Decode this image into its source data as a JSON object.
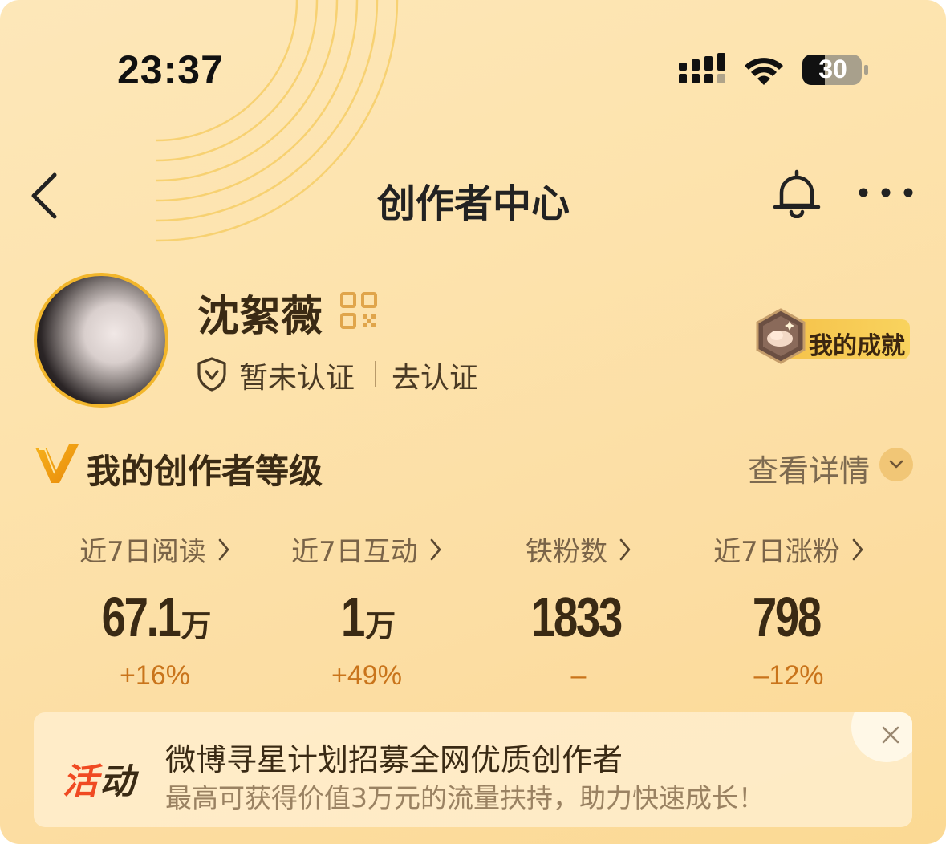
{
  "status_bar": {
    "time": "23:37",
    "battery_level": "30",
    "icons": [
      "signal-icon",
      "wifi-icon",
      "battery-icon"
    ]
  },
  "nav": {
    "title": "创作者中心",
    "back_icon": "chevron-left-icon",
    "bell_icon": "bell-icon",
    "more_icon": "more-horizontal-icon"
  },
  "profile": {
    "name": "沈絮薇",
    "qr_icon": "qr-code-icon",
    "verify_status": "暂未认证",
    "verify_link": "去认证",
    "achievement_label": "我的成就"
  },
  "level": {
    "title": "我的创作者等级",
    "detail_link": "查看详情"
  },
  "stats": [
    {
      "label": "近7日阅读",
      "value": "67.1",
      "unit": "万",
      "change": "+16%"
    },
    {
      "label": "近7日互动",
      "value": "1",
      "unit": "万",
      "change": "+49%"
    },
    {
      "label": "铁粉数",
      "value": "1833",
      "unit": "",
      "change": "–"
    },
    {
      "label": "近7日涨粉",
      "value": "798",
      "unit": "",
      "change": "–12%"
    }
  ],
  "banner": {
    "tag_part1": "活",
    "tag_part2": "动",
    "title": "微博寻星计划招募全网优质创作者",
    "subtitle": "最高可获得价值3万元的流量扶持，助力快速成长！"
  },
  "colors": {
    "background": "#fde3ad",
    "accent_gold": "#f2b62b",
    "change_orange": "#c9741b",
    "tag_red": "#f04a22",
    "text_dark": "#3a2a14"
  }
}
